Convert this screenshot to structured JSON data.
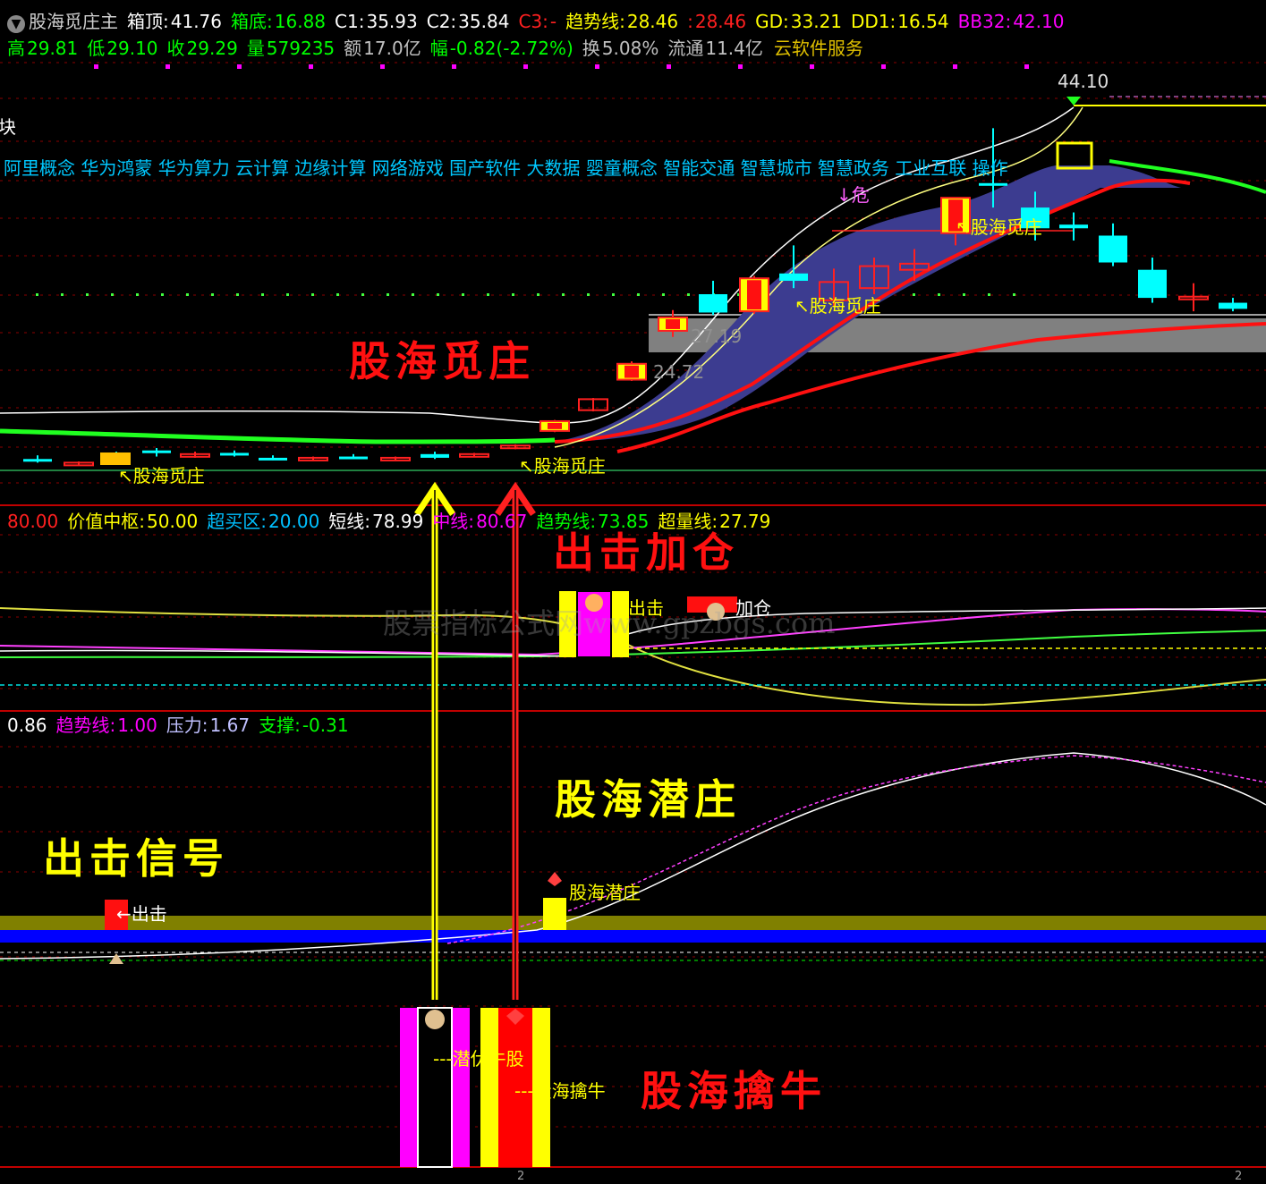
{
  "header": {
    "indicator_name": "股海觅庄主",
    "row1": [
      {
        "label": "箱顶:",
        "value": "41.76",
        "color": "#ffffff"
      },
      {
        "label": "箱底:",
        "value": "16.88",
        "color": "#00ff00"
      },
      {
        "label": "C1:",
        "value": "35.93",
        "color": "#ffffff"
      },
      {
        "label": "C2:",
        "value": "35.84",
        "color": "#ffffff"
      },
      {
        "label": "C3:",
        "value": "-",
        "color": "#ff2020"
      },
      {
        "label": "趋势线:",
        "value": "28.46",
        "color": "#ffff00"
      },
      {
        "label": ":",
        "value": "28.46",
        "color": "#ff2020"
      },
      {
        "label": "GD:",
        "value": "33.21",
        "color": "#ffff00"
      },
      {
        "label": "DD1:",
        "value": "16.54",
        "color": "#ffff00"
      },
      {
        "label": "BB32:",
        "value": "42.10",
        "color": "#ff00ff"
      }
    ],
    "row2": [
      {
        "label": "高",
        "value": "29.81",
        "color": "#00ff00"
      },
      {
        "label": "低",
        "value": "29.10",
        "color": "#00ff00"
      },
      {
        "label": "收",
        "value": "29.29",
        "color": "#00ff00"
      },
      {
        "label": "量",
        "value": "579235",
        "color": "#00ff00"
      },
      {
        "label": "额",
        "value": "17.0亿",
        "color": "#c0c0c0"
      },
      {
        "label": "幅",
        "value": "-0.82(-2.72%)",
        "color": "#00ff00"
      },
      {
        "label": "换",
        "value": "5.08%",
        "color": "#c0c0c0"
      },
      {
        "label": "流通",
        "value": "11.4亿",
        "color": "#c0c0c0"
      },
      {
        "label": "",
        "value": "云软件服务",
        "color": "#e0c000"
      }
    ]
  },
  "sector_label": "块",
  "concepts": "阿里概念 华为鸿蒙 华为算力 云计算 边缘计算 网络游戏 国产软件 大数据 婴童概念 智能交通 智慧城市 智慧政务 工业互联 操作",
  "price_marks": {
    "high": "44.10",
    "box_hi": "27.19",
    "box_lo": "24.72"
  },
  "panel1_tags": {
    "left": "股海觅庄",
    "mid": "股海觅庄",
    "upper": "股海觅庄",
    "danger": "危",
    "old": "股海觅庄"
  },
  "panel2_header": [
    {
      "label": "",
      "value": "80.00",
      "color": "#ff2020"
    },
    {
      "label": "价值中枢:",
      "value": "50.00",
      "color": "#ffff00"
    },
    {
      "label": "超买区:",
      "value": "20.00",
      "color": "#00c0ff"
    },
    {
      "label": "短线:",
      "value": "78.99",
      "color": "#ffffff"
    },
    {
      "label": "中线:",
      "value": "80.67",
      "color": "#ff00ff"
    },
    {
      "label": "趋势线:",
      "value": "73.85",
      "color": "#00ff00"
    },
    {
      "label": "超量线:",
      "value": "27.79",
      "color": "#ffff00"
    }
  ],
  "panel2_tags": {
    "strike": "出击",
    "add": "加仓"
  },
  "panel3_header": [
    {
      "label": "",
      "value": "0.86",
      "color": "#ffffff"
    },
    {
      "label": "趋势线:",
      "value": "1.00",
      "color": "#ff00ff"
    },
    {
      "label": "压力:",
      "value": "1.67",
      "color": "#c0c0ff"
    },
    {
      "label": "支撑:",
      "value": "-0.31",
      "color": "#00ff00"
    }
  ],
  "panel3_tags": {
    "strike": "出击",
    "latent": "股海潜庄"
  },
  "panel4_tags": {
    "latent_bull": "---潜伏牛股",
    "catch_bull": "---股海擒牛"
  },
  "annotations": {
    "mi_zhuang": "股海觅庄",
    "add_position": "出击加仓",
    "qian_zhuang": "股海潜庄",
    "strike_signal": "出击信号",
    "qin_niu": "股海擒牛"
  },
  "watermark": "股票指标公式网www.gpzbgs.com",
  "axis_marks": [
    "2",
    "2"
  ],
  "colors": {
    "bg": "#000000",
    "grid": "#8b0000",
    "up": "#ff2020",
    "down": "#00ffff",
    "ribbon": "#3a3a8c",
    "accent_red": "#ff1010",
    "accent_yellow": "#ffff00"
  },
  "chart_data": {
    "type": "line",
    "panels": [
      {
        "name": "main_price",
        "candles": [
          {
            "o": 17.0,
            "h": 17.3,
            "l": 16.7,
            "c": 16.8,
            "dir": "down"
          },
          {
            "o": 16.6,
            "h": 16.8,
            "l": 16.5,
            "c": 16.7,
            "dir": "up"
          },
          {
            "o": 17.3,
            "h": 17.6,
            "l": 16.9,
            "c": 17.1,
            "dir": "down"
          },
          {
            "o": 17.5,
            "h": 17.9,
            "l": 17.2,
            "c": 17.7,
            "dir": "down"
          },
          {
            "o": 17.3,
            "h": 17.6,
            "l": 17.1,
            "c": 17.4,
            "dir": "up"
          },
          {
            "o": 17.5,
            "h": 17.7,
            "l": 17.2,
            "c": 17.3,
            "dir": "down"
          },
          {
            "o": 17.1,
            "h": 17.3,
            "l": 16.9,
            "c": 17.0,
            "dir": "down"
          },
          {
            "o": 17.0,
            "h": 17.2,
            "l": 16.9,
            "c": 17.1,
            "dir": "up"
          },
          {
            "o": 17.2,
            "h": 17.4,
            "l": 17.0,
            "c": 17.0,
            "dir": "down"
          },
          {
            "o": 17.0,
            "h": 17.2,
            "l": 16.9,
            "c": 17.1,
            "dir": "up"
          },
          {
            "o": 17.4,
            "h": 17.6,
            "l": 17.0,
            "c": 17.1,
            "dir": "down"
          },
          {
            "o": 17.3,
            "h": 17.5,
            "l": 17.2,
            "c": 17.4,
            "dir": "up"
          },
          {
            "o": 18.0,
            "h": 18.2,
            "l": 17.8,
            "c": 18.1,
            "dir": "up"
          },
          {
            "o": 19.3,
            "h": 20.2,
            "l": 19.2,
            "c": 20.1,
            "dir": "up"
          },
          {
            "o": 21.0,
            "h": 22.0,
            "l": 20.9,
            "c": 21.9,
            "dir": "up"
          },
          {
            "o": 23.5,
            "h": 25.0,
            "l": 23.4,
            "c": 24.8,
            "dir": "up"
          },
          {
            "o": 27.5,
            "h": 29.2,
            "l": 27.0,
            "c": 28.6,
            "dir": "up"
          },
          {
            "o": 30.5,
            "h": 31.6,
            "l": 28.8,
            "c": 29.0,
            "dir": "down"
          },
          {
            "o": 29.1,
            "h": 32.0,
            "l": 28.9,
            "c": 31.8,
            "dir": "up"
          },
          {
            "o": 32.2,
            "h": 34.5,
            "l": 31.0,
            "c": 31.6,
            "dir": "down"
          },
          {
            "o": 31.5,
            "h": 32.6,
            "l": 29.5,
            "c": 30.0,
            "dir": "up"
          },
          {
            "o": 31.0,
            "h": 33.5,
            "l": 30.5,
            "c": 32.8,
            "dir": "up"
          },
          {
            "o": 33.0,
            "h": 34.2,
            "l": 31.6,
            "c": 32.5,
            "dir": "up"
          },
          {
            "o": 35.5,
            "h": 38.4,
            "l": 34.5,
            "c": 38.4,
            "dir": "up"
          },
          {
            "o": 39.4,
            "h": 44.1,
            "l": 37.6,
            "c": 39.6,
            "dir": "down"
          },
          {
            "o": 37.6,
            "h": 38.9,
            "l": 34.9,
            "c": 35.9,
            "dir": "down"
          },
          {
            "o": 36.2,
            "h": 37.2,
            "l": 34.9,
            "c": 35.9,
            "dir": "down"
          },
          {
            "o": 35.3,
            "h": 36.3,
            "l": 32.8,
            "c": 33.1,
            "dir": "down"
          },
          {
            "o": 32.5,
            "h": 33.5,
            "l": 29.8,
            "c": 30.2,
            "dir": "down"
          },
          {
            "o": 30.3,
            "h": 31.4,
            "l": 29.1,
            "c": 30.3,
            "dir": "up"
          },
          {
            "o": 29.8,
            "h": 30.2,
            "l": 29.1,
            "c": 29.3,
            "dir": "down"
          }
        ]
      },
      {
        "name": "oscillator",
        "ylim": [
          0,
          100
        ],
        "levels": [
          80,
          50,
          20
        ]
      },
      {
        "name": "trend",
        "values": {
          "current": 0.86,
          "trend": 1.0,
          "pressure": 1.67,
          "support": -0.31
        }
      },
      {
        "name": "signal_bars",
        "bars": [
          "潜伏牛股",
          "股海擒牛"
        ]
      }
    ]
  }
}
